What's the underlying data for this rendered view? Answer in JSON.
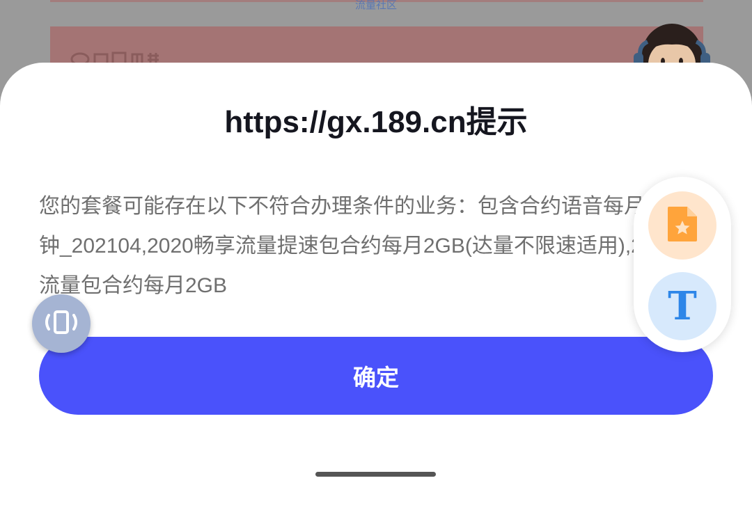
{
  "background": {
    "community_label": "流量社区"
  },
  "dialog": {
    "title": "https://gx.189.cn提示",
    "message": "您的套餐可能存在以下不符合办理条件的业务：包含合约语音每月200分钟_202104,2020畅享流量提速包合约每月2GB(达量不限速适用),2020年流量包合约每月2GB",
    "confirm_label": "确定"
  },
  "floating": {
    "vibrate_icon": "vibrate-icon",
    "doc_icon": "starred-document-icon",
    "text_icon": "text-format-icon",
    "text_glyph": "T"
  },
  "colors": {
    "accent": "#4a52fb",
    "doc_bg": "#ffe5cc",
    "doc_fg": "#ffa43b",
    "text_bg": "#d7e9fc",
    "text_fg": "#2d86e8",
    "vibrate_bg": "#a5b4d3"
  }
}
